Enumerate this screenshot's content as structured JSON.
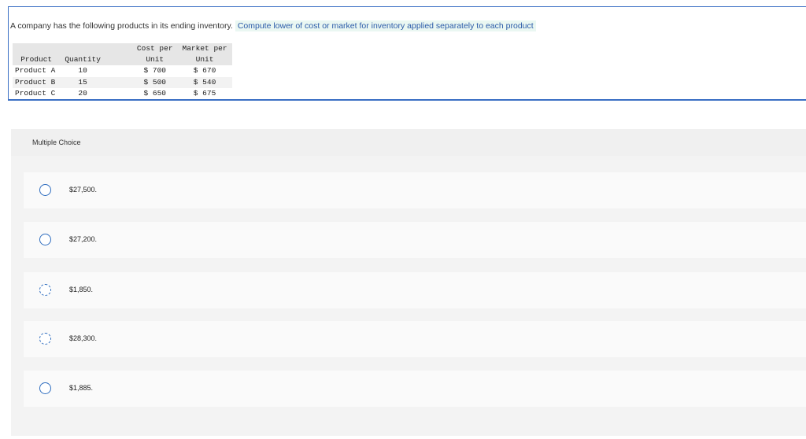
{
  "question": {
    "intro": "A company has the following products in its ending inventory.",
    "instruction": "Compute lower of cost or market for inventory applied separately to each product"
  },
  "table": {
    "headers": {
      "product": "Product",
      "quantity": "Quantity",
      "cost_line1": "Cost per",
      "cost_line2": "Unit",
      "market_line1": "Market per",
      "market_line2": "Unit"
    },
    "rows": [
      {
        "product": "Product A",
        "quantity": "10",
        "cost": "$ 700",
        "market": "$ 670"
      },
      {
        "product": "Product B",
        "quantity": "15",
        "cost": "$ 500",
        "market": "$ 540"
      },
      {
        "product": "Product C",
        "quantity": "20",
        "cost": "$ 650",
        "market": "$ 675"
      }
    ]
  },
  "multiple_choice": {
    "title": "Multiple Choice",
    "options": [
      {
        "label": "$27,500."
      },
      {
        "label": "$27,200."
      },
      {
        "label": "$1,850."
      },
      {
        "label": "$28,300."
      },
      {
        "label": "$1,885."
      }
    ]
  },
  "colors": {
    "accent": "#3a6fc4",
    "highlight_bg": "#eaf7f2",
    "panel_bg": "#f3f3f3"
  }
}
